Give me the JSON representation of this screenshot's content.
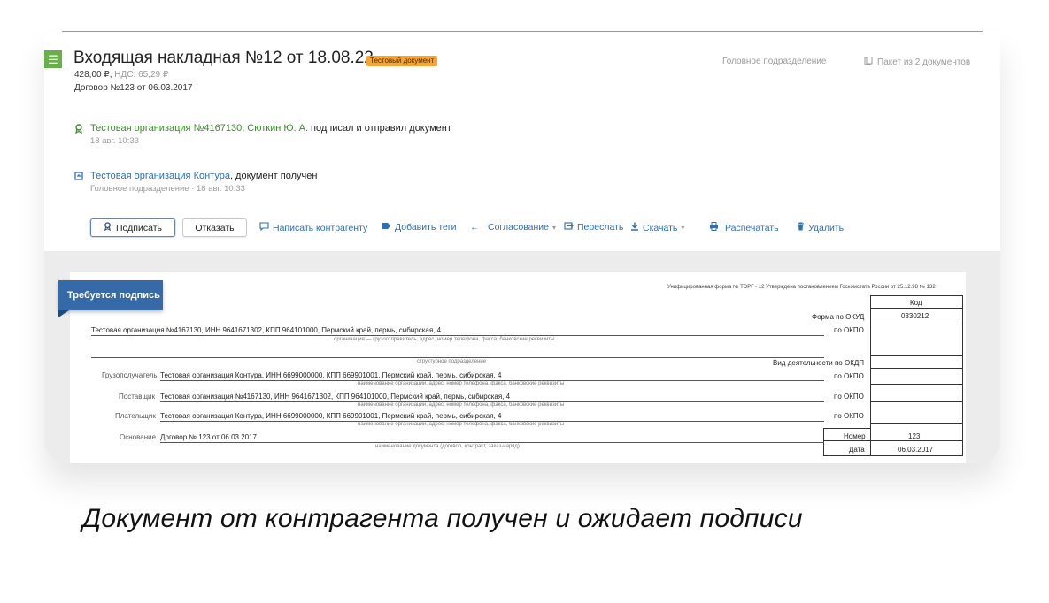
{
  "header": {
    "doc_title": "Входящая накладная №12 от 18.08.22",
    "badge": "Тестовый документ",
    "amount": "428,00 ₽,",
    "vat": "НДС: 65,29 ₽",
    "contract": "Договор №123 от 06.03.2017",
    "department": "Головное подразделение",
    "package": "Пакет из 2 документов"
  },
  "events": [
    {
      "org": "Тестовая организация №4167130, Сюткин Ю. А.",
      "action": " подписал и отправил документ",
      "time": "18 авг. 10:33"
    },
    {
      "org": "Тестовая организация Контура",
      "action": ", документ получен",
      "time": "Головное подразделение · 18 авг. 10:33"
    }
  ],
  "actions": {
    "sign": "Подписать",
    "refuse": "Отказать",
    "write": "Написать контрагенту",
    "tags": "Добавить теги",
    "approval": "Согласование",
    "forward": "Переслать",
    "download": "Скачать",
    "print": "Распечатать",
    "delete": "Удалить"
  },
  "form": {
    "flag": "Требуется подпись",
    "unified": "Унифицированная форма № ТОРГ - 12 Утверждена постановлением Госкомстата России от 25.12.98 № 132",
    "kod": "Код",
    "okud_label": "Форма по ОКУД",
    "okud_value": "0330212",
    "okpo_label": "по ОКПО",
    "okdp_label": "Вид деятельности по ОКДП",
    "sender_org": "Тестовая организация №4167130, ИНН 9641671302, КПП 964101000, Пермский край, пермь, сибирская, 4",
    "sender_caption": "организация — грузоотправитель, адрес, номер телефона, факса, банковские реквизиты",
    "subdivision_caption": "структурное подразделение",
    "consignee_label": "Грузополучатель",
    "consignee": "Тестовая организация Контура, ИНН 6699000000, КПП 669901001, Пермский край, пермь, сибирская, 4",
    "org_caption": "наименование организации, адрес, номер телефона, факса, банковские реквизиты",
    "supplier_label": "Поставщик",
    "supplier": "Тестовая организация №4167130, ИНН 9641671302, КПП 964101000, Пермский край, пермь, сибирская, 4",
    "payer_label": "Плательщик",
    "payer": "Тестовая организация Контура, ИНН 6699000000, КПП 669901001, Пермский край, пермь, сибирская, 4",
    "basis_label": "Основание",
    "basis": "Договор № 123 от 06.03.2017",
    "basis_caption": "наименование документа (договор, контракт, заказ-наряд)",
    "number_label": "Номер",
    "number_value": "123",
    "date_label": "Дата",
    "date_value": "06.03.2017"
  },
  "caption": "Документ от контрагента получен и ожидает подписи"
}
